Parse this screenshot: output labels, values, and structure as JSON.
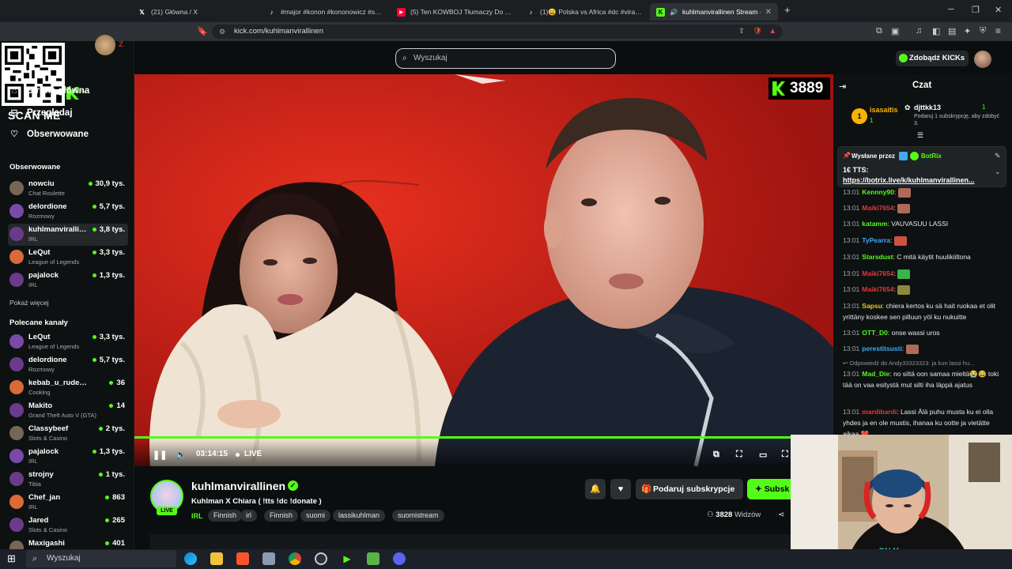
{
  "browser": {
    "tabs": [
      {
        "label": "(21) Główna / X",
        "icon": "x-logo-icon"
      },
      {
        "label": "#major #konon #kononowicz #szkoł",
        "icon": "tiktok-icon"
      },
      {
        "label": "(5) Ten KOWBOJ Tłumaczy Do Czego",
        "icon": "youtube-icon"
      },
      {
        "label": "(1)😀 Polska vs Africa #dc #viral #fyp",
        "icon": "tiktok-icon"
      },
      {
        "label": "kuhlmanvirallinen Stream - W",
        "icon": "kick-icon",
        "active": true
      }
    ],
    "url": "kick.com/kuhlmanvirallinen"
  },
  "overlay": {
    "scan_me": "SCAN ME",
    "beta": "BETA"
  },
  "header": {
    "search_placeholder": "Wyszukaj",
    "kicks_button": "Zdobądź KICKs"
  },
  "sidebar": {
    "nav": [
      {
        "label": "Strona główna",
        "icon": "home-icon"
      },
      {
        "label": "Przeglądaj",
        "icon": "browse-icon"
      },
      {
        "label": "Obserwowane",
        "icon": "heart-icon"
      }
    ],
    "followed_title": "Obserwowane",
    "followed": [
      {
        "name": "nowciu",
        "category": "Chat Roulette",
        "viewers": "30,9 tys."
      },
      {
        "name": "delordione",
        "category": "Rozmowy",
        "viewers": "5,7 tys."
      },
      {
        "name": "kuhlmanvirallinen",
        "category": "IRL",
        "viewers": "3,8 tys.",
        "selected": true
      },
      {
        "name": "LeQut",
        "category": "League of Legends",
        "viewers": "3,3 tys."
      },
      {
        "name": "pajalock",
        "category": "IRL",
        "viewers": "1,3 tys."
      }
    ],
    "show_more": "Pokaż więcej",
    "recommended_title": "Polecane kanały",
    "recommended": [
      {
        "name": "LeQut",
        "category": "League of Legends",
        "viewers": "3,3 tys."
      },
      {
        "name": "delordione",
        "category": "Rozmowy",
        "viewers": "5,7 tys."
      },
      {
        "name": "kebab_u_rudego",
        "category": "Cooking",
        "viewers": "36"
      },
      {
        "name": "Makito",
        "category": "Grand Theft Auto V (GTA)",
        "viewers": "14"
      },
      {
        "name": "Classybeef",
        "category": "Slots & Casino",
        "viewers": "2 tys."
      },
      {
        "name": "pajalock",
        "category": "IRL",
        "viewers": "1,3 tys."
      },
      {
        "name": "strojny",
        "category": "Tibia",
        "viewers": "1 tys."
      },
      {
        "name": "Chef_jan",
        "category": "IRL",
        "viewers": "863"
      },
      {
        "name": "Jared",
        "category": "Slots & Casino",
        "viewers": "265"
      },
      {
        "name": "Maxigashi",
        "category": "",
        "viewers": "401"
      }
    ]
  },
  "player": {
    "viewer_badge": "3889",
    "time": "03:14:15",
    "live": "LIVE"
  },
  "stream": {
    "streamer": "kuhlmanvirallinen",
    "live_pill": "LIVE",
    "title": "Kuhlman X Chiara ( !tts !dc !donate )",
    "category": "IRL",
    "tags": [
      "Finnish",
      "irl",
      "Finnish",
      "suomi",
      "lassikuhlman",
      "suomistream"
    ],
    "gift_button": "Podaruj subskrypcje",
    "subscribe_button": "Subsk",
    "viewers_count": "3828",
    "viewers_label": "Widzów"
  },
  "chat": {
    "title": "Czat",
    "gifter1": {
      "rank": "1",
      "name": "isasaitis",
      "count": "1"
    },
    "gifter2": {
      "name": "djttkk13",
      "count": "1",
      "hint": "Podaruj 1 subskrypcję, aby zdobyć 3."
    },
    "pinned": {
      "sent_by": "Wysłane przez",
      "bot": "BotRix",
      "line1": "1€ TTS:",
      "line2": "https://botrix.live/k/kuhlmanvirallinen..."
    },
    "messages": [
      {
        "time": "13:01",
        "user": "Kennny90",
        "color": "#53fc18",
        "text": "",
        "emote": "#b06a5a"
      },
      {
        "time": "13:01",
        "user": "Maiki7654",
        "color": "#e03a3a",
        "text": "",
        "emote": "#b06a5a"
      },
      {
        "time": "13:01",
        "user": "katamm",
        "color": "#53fc18",
        "text": "VAUVASUU LASSI"
      },
      {
        "time": "13:01",
        "user": "TyPearra",
        "color": "#3fa9f5",
        "text": "",
        "emote": "#d0513e"
      },
      {
        "time": "13:01",
        "user": "Starsdust",
        "color": "#53fc18",
        "text": "C mitä käytit huulikiiltona"
      },
      {
        "time": "13:01",
        "user": "Maiki7654",
        "color": "#e03a3a",
        "text": "",
        "emote": "#3ab54a"
      },
      {
        "time": "13:01",
        "user": "Maiki7654",
        "color": "#e03a3a",
        "text": "",
        "emote": "#8a8a3a"
      },
      {
        "time": "13:01",
        "user": "Sapsu",
        "color": "#f5c518",
        "text": "chiera kertos ku sä hait ruokaa et olit yrittäny koskee sen pilluun yöl ku nukuitte"
      },
      {
        "time": "13:01",
        "user": "OTT_D0",
        "color": "#53fc18",
        "text": "onse wassi uros"
      },
      {
        "time": "13:01",
        "user": "perestitsusti",
        "color": "#3fa9f5",
        "text": "",
        "emote": "#b06a5a"
      },
      {
        "reply": "Odpowiedź do Andy33323323: ja kun lassi hu..."
      },
      {
        "time": "13:01",
        "user": "Mad_Die",
        "color": "#53fc18",
        "text": "no siltä oon samaa mieltä😭😂 toki tää on vaa esitystä mut silti iha läppä ajatus"
      },
      {
        "time": "13:01",
        "user": "mardibardi",
        "color": "#e03a3a",
        "text": "Lassi Älä puhu musta ku ei olla yhdes ja en ole mustis, ihanaa ku ootte ja vietätte aikaa ❤️"
      }
    ]
  },
  "taskbar": {
    "search_placeholder": "Wyszukaj"
  }
}
